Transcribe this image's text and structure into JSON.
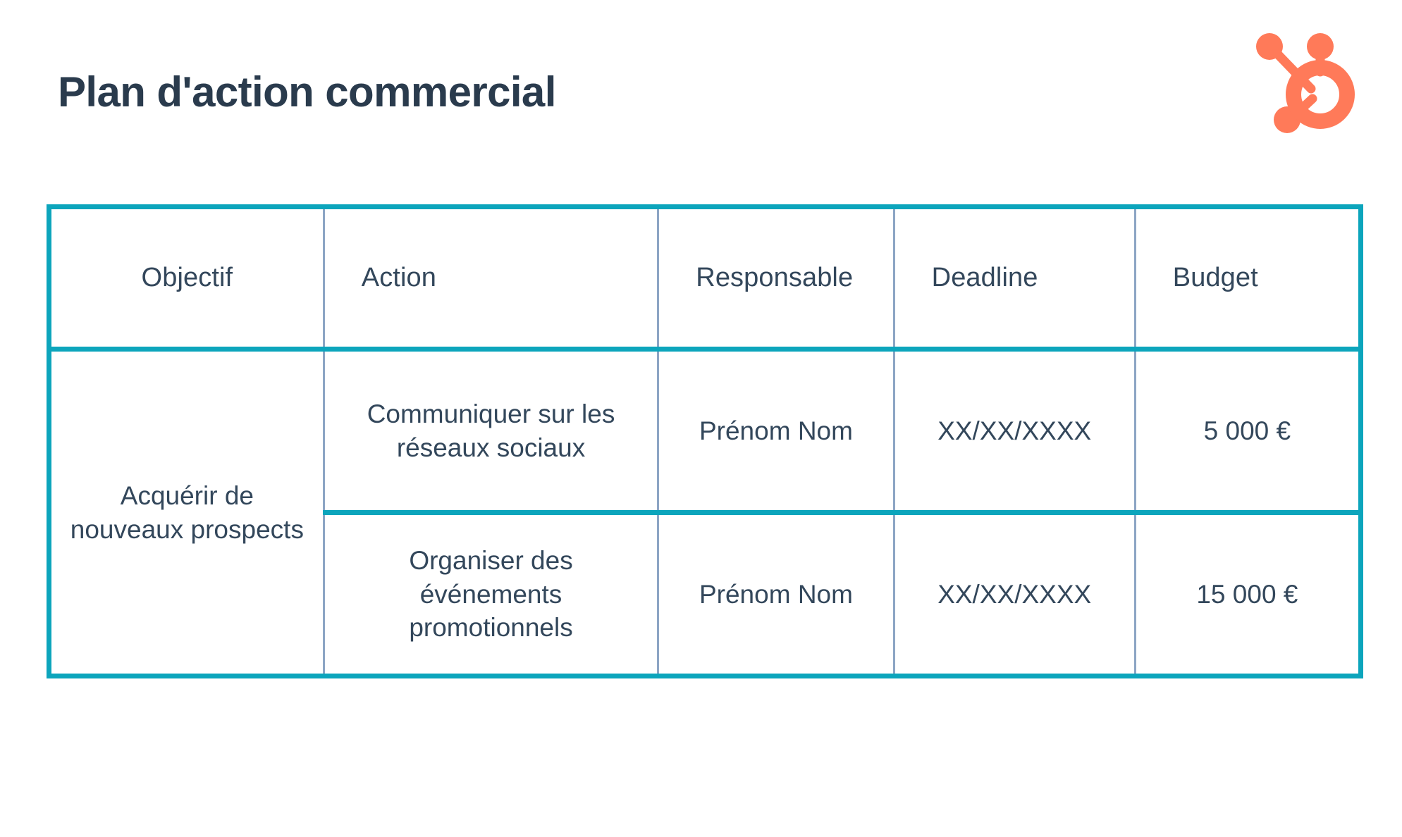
{
  "document": {
    "title": "Plan d'action commercial",
    "brand_logo_name": "hubspot-sprocket-logo",
    "accent_color": "#0CA5BC",
    "brand_color": "#FF7A59",
    "text_color": "#33475B",
    "title_color": "#2A3B4D",
    "divider_color": "#8CA5C4",
    "background_color": "#FFFFFF"
  },
  "table": {
    "columns": [
      {
        "key": "objectif",
        "label": "Objectif"
      },
      {
        "key": "action",
        "label": "Action"
      },
      {
        "key": "responsable",
        "label": "Responsable"
      },
      {
        "key": "deadline",
        "label": "Deadline"
      },
      {
        "key": "budget",
        "label": "Budget"
      }
    ],
    "objective_group": {
      "label": "Acquérir de nouveaux prospects",
      "rowspan": 2
    },
    "rows": [
      {
        "action": "Communiquer sur les réseaux sociaux",
        "responsable": "Prénom Nom",
        "deadline": "XX/XX/XXXX",
        "budget": "5 000 €"
      },
      {
        "action": "Organiser des événements promotionnels",
        "responsable": "Prénom Nom",
        "deadline": "XX/XX/XXXX",
        "budget": "15 000 €"
      }
    ]
  }
}
